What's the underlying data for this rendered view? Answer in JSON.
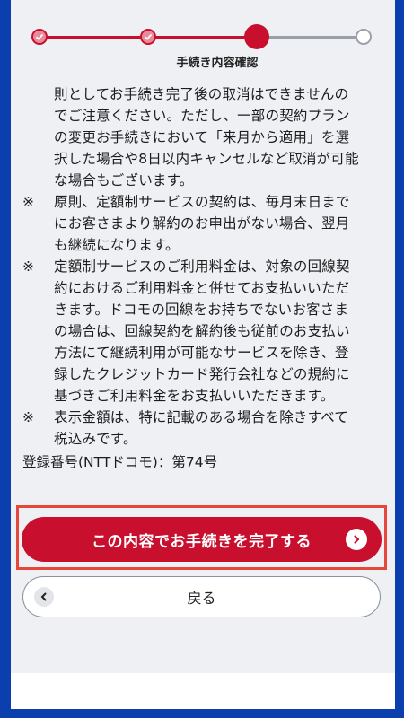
{
  "stepper": {
    "current_label": "手続き内容確認"
  },
  "content": {
    "intro_lines": [
      "則としてお手続き完了後の取消はできませんの",
      "でご注意ください。ただし、一部の契約プラン",
      "の変更お手続きにおいて「来月から適用」を選",
      "択した場合や8日以内キャンセルなど取消が可能",
      "な場合もございます。"
    ],
    "notes": [
      {
        "mark": "※",
        "lines": [
          "原則、定額制サービスの契約は、毎月末日まで",
          "にお客さまより解約のお申出がない場合、翌月",
          "も継続になります。"
        ]
      },
      {
        "mark": "※",
        "lines": [
          "定額制サービスのご利用料金は、対象の回線契",
          "約におけるご利用料金と併せてお支払いいただ",
          "きます。ドコモの回線をお持ちでないお客さま",
          "の場合は、回線契約を解約後も従前のお支払い",
          "方法にて継続利用が可能なサービスを除き、登",
          "録したクレジットカード発行会社などの規約に",
          "基づきご利用料金をお支払いいただきます。"
        ]
      },
      {
        "mark": "※",
        "lines": [
          "表示金額は、特に記載のある場合を除きすべて",
          "税込みです。"
        ]
      }
    ],
    "registration": "登録番号(NTTドコモ)：第74号"
  },
  "actions": {
    "complete_label": "この内容でお手続きを完了する",
    "back_label": "戻る"
  },
  "colors": {
    "accent": "#c8102e",
    "frame": "#0b3fae",
    "highlight": "#e5473a"
  }
}
